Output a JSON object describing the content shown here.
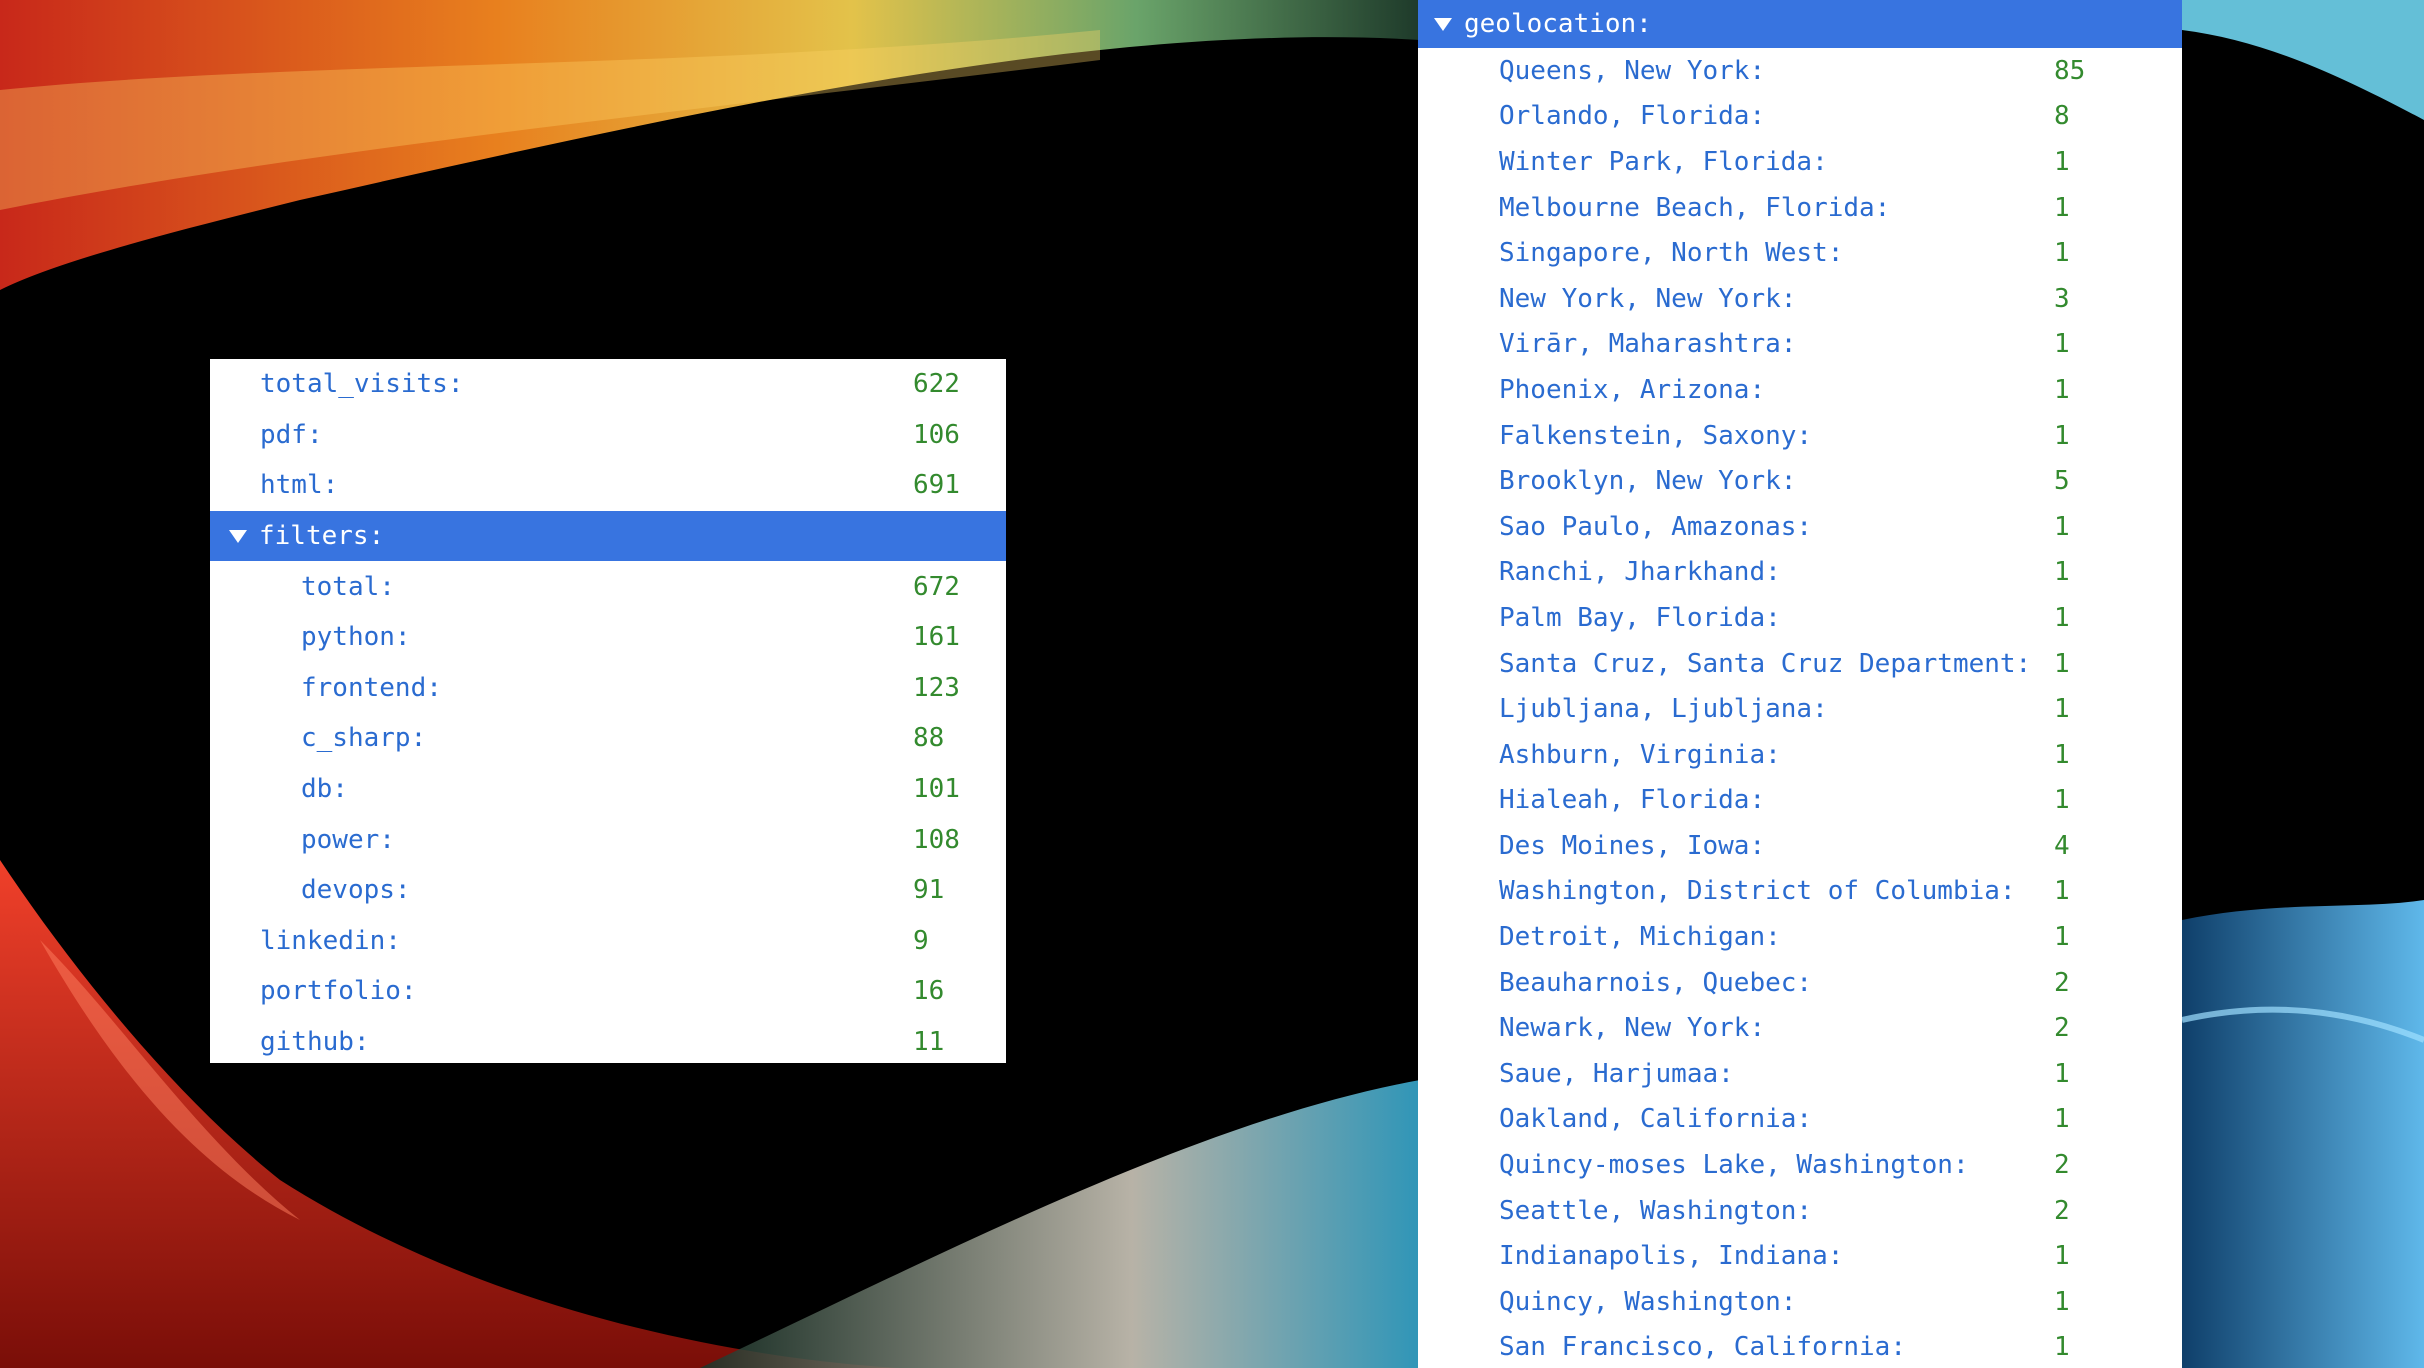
{
  "stats": {
    "top_rows": [
      {
        "key": "total_visits:",
        "value": "622"
      },
      {
        "key": "pdf:",
        "value": "106"
      },
      {
        "key": "html:",
        "value": "691"
      }
    ],
    "filters_label": "filters:",
    "filters": [
      {
        "key": "total:",
        "value": "672"
      },
      {
        "key": "python:",
        "value": "161"
      },
      {
        "key": "frontend:",
        "value": "123"
      },
      {
        "key": "c_sharp:",
        "value": "88"
      },
      {
        "key": "db:",
        "value": "101"
      },
      {
        "key": "power:",
        "value": "108"
      },
      {
        "key": "devops:",
        "value": "91"
      }
    ],
    "bottom_rows": [
      {
        "key": "linkedin:",
        "value": "9"
      },
      {
        "key": "portfolio:",
        "value": "16"
      },
      {
        "key": "github:",
        "value": "11"
      }
    ]
  },
  "geolocation": {
    "label": "geolocation:",
    "rows": [
      {
        "key": "Queens, New York:",
        "value": "85"
      },
      {
        "key": "Orlando, Florida:",
        "value": "8"
      },
      {
        "key": "Winter Park, Florida:",
        "value": "1"
      },
      {
        "key": "Melbourne Beach, Florida:",
        "value": "1"
      },
      {
        "key": "Singapore, North West:",
        "value": "1"
      },
      {
        "key": "New York, New York:",
        "value": "3"
      },
      {
        "key": "Virār, Maharashtra:",
        "value": "1"
      },
      {
        "key": "Phoenix, Arizona:",
        "value": "1"
      },
      {
        "key": "Falkenstein, Saxony:",
        "value": "1"
      },
      {
        "key": "Brooklyn, New York:",
        "value": "5"
      },
      {
        "key": "Sao Paulo, Amazonas:",
        "value": "1"
      },
      {
        "key": "Ranchi, Jharkhand:",
        "value": "1"
      },
      {
        "key": "Palm Bay, Florida:",
        "value": "1"
      },
      {
        "key": "Santa Cruz, Santa Cruz Department:",
        "value": "1"
      },
      {
        "key": "Ljubljana, Ljubljana:",
        "value": "1"
      },
      {
        "key": "Ashburn, Virginia:",
        "value": "1"
      },
      {
        "key": "Hialeah, Florida:",
        "value": "1"
      },
      {
        "key": "Des Moines, Iowa:",
        "value": "4"
      },
      {
        "key": "Washington, District of Columbia:",
        "value": "1"
      },
      {
        "key": "Detroit, Michigan:",
        "value": "1"
      },
      {
        "key": "Beauharnois, Quebec:",
        "value": "2"
      },
      {
        "key": "Newark, New York:",
        "value": "2"
      },
      {
        "key": "Saue, Harjumaa:",
        "value": "1"
      },
      {
        "key": "Oakland, California:",
        "value": "1"
      },
      {
        "key": "Quincy-moses Lake, Washington:",
        "value": "2"
      },
      {
        "key": "Seattle, Washington:",
        "value": "2"
      },
      {
        "key": "Indianapolis, Indiana:",
        "value": "1"
      },
      {
        "key": "Quincy, Washington:",
        "value": "1"
      },
      {
        "key": "San Francisco, California:",
        "value": "1"
      }
    ]
  },
  "colors": {
    "key_text": "#2a6bd0",
    "value_text": "#338a2e",
    "selected_row_bg": "#3874e0",
    "panel_bg": "#ffffff",
    "desktop_bg": "#000000"
  },
  "icons": {
    "expanded_arrow": "triangle-down-icon"
  }
}
